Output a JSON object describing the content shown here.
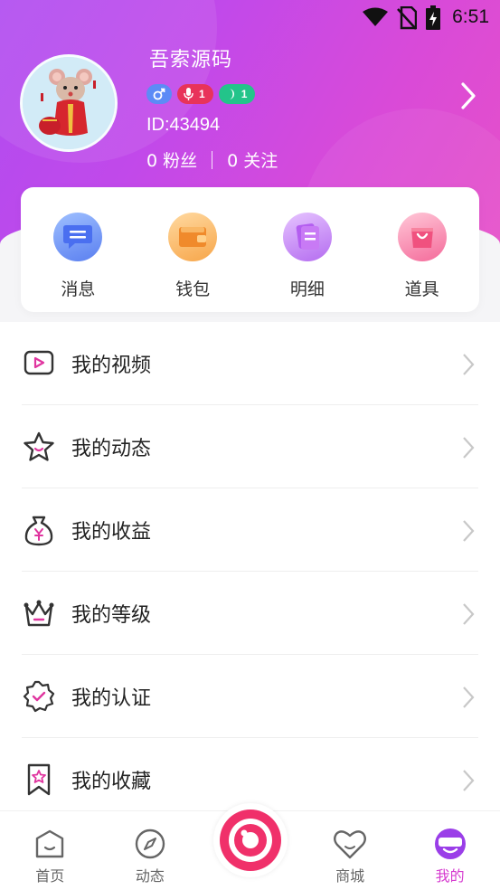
{
  "status_bar": {
    "time": "6:51"
  },
  "profile": {
    "name": "吾索源码",
    "badges": {
      "host_level": "1",
      "vip_level": "1"
    },
    "id_text": "ID:43494",
    "fans_text": "0 粉丝",
    "follow_text": "0 关注"
  },
  "quick_actions": [
    {
      "label": "消息",
      "icon": "message-icon"
    },
    {
      "label": "钱包",
      "icon": "wallet-icon"
    },
    {
      "label": "明细",
      "icon": "details-icon"
    },
    {
      "label": "道具",
      "icon": "props-bag-icon"
    }
  ],
  "menu": [
    {
      "label": "我的视频",
      "icon": "video-icon"
    },
    {
      "label": "我的动态",
      "icon": "star-icon"
    },
    {
      "label": "我的收益",
      "icon": "money-bag-icon"
    },
    {
      "label": "我的等级",
      "icon": "crown-icon"
    },
    {
      "label": "我的认证",
      "icon": "verified-badge-icon"
    },
    {
      "label": "我的收藏",
      "icon": "bookmark-star-icon"
    }
  ],
  "tabbar": {
    "home": "首页",
    "moments": "动态",
    "mall": "商城",
    "mine": "我的"
  },
  "colors": {
    "header_gradient_start": "#b04cf0",
    "header_gradient_end": "#e650c9",
    "active_tab": "#d63bcf",
    "center_button": "#f0306a"
  }
}
